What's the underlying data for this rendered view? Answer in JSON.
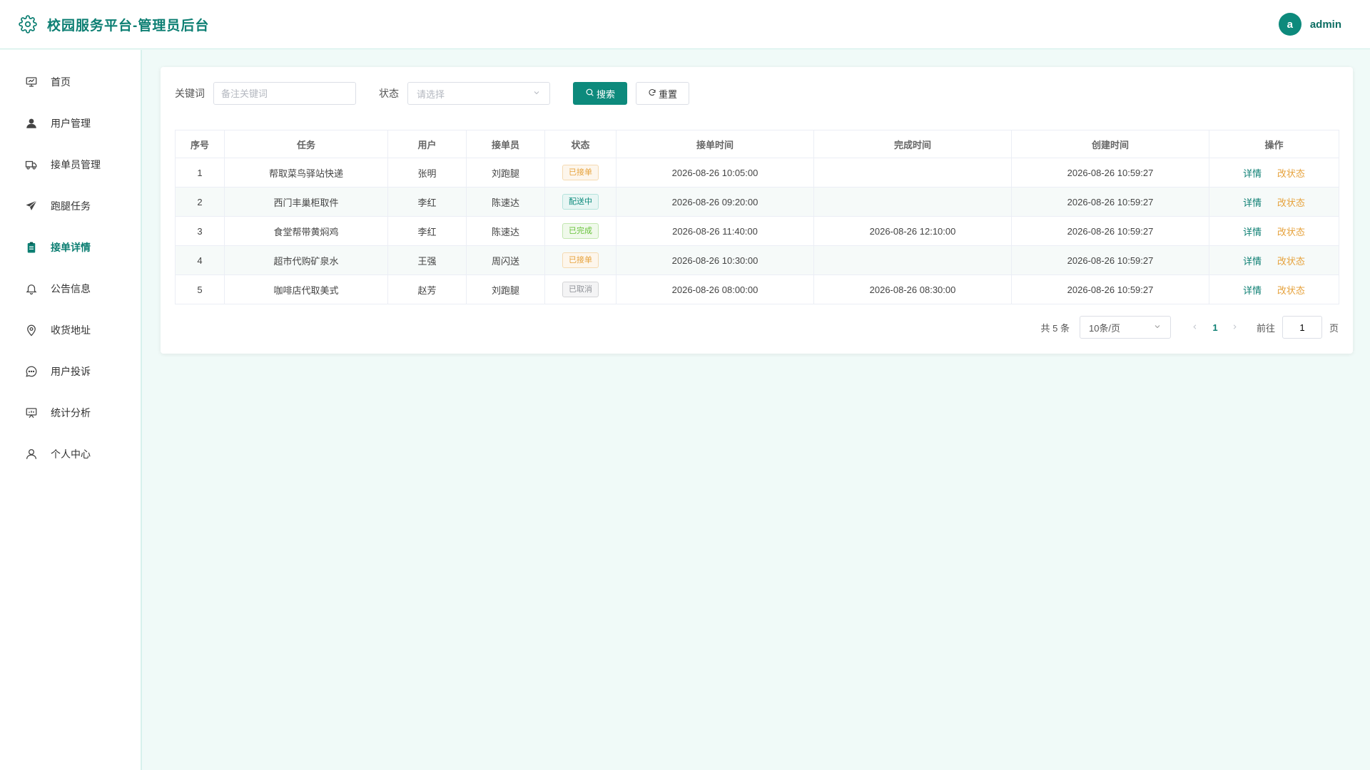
{
  "header": {
    "title": "校园服务平台-管理员后台",
    "avatar_letter": "a",
    "username": "admin"
  },
  "sidebar": {
    "items": [
      {
        "label": "首页",
        "icon": "monitor-icon"
      },
      {
        "label": "用户管理",
        "icon": "user-icon"
      },
      {
        "label": "接单员管理",
        "icon": "truck-icon"
      },
      {
        "label": "跑腿任务",
        "icon": "send-icon"
      },
      {
        "label": "接单详情",
        "icon": "clipboard-icon",
        "active": true
      },
      {
        "label": "公告信息",
        "icon": "bell-icon"
      },
      {
        "label": "收货地址",
        "icon": "location-icon"
      },
      {
        "label": "用户投诉",
        "icon": "chat-icon"
      },
      {
        "label": "统计分析",
        "icon": "chart-board-icon"
      },
      {
        "label": "个人中心",
        "icon": "person-outline-icon"
      }
    ]
  },
  "filters": {
    "keyword_label": "关键词",
    "keyword_placeholder": "备注关键词",
    "keyword_value": "",
    "status_label": "状态",
    "status_placeholder": "请选择",
    "search_label": "搜索",
    "reset_label": "重置"
  },
  "table": {
    "headers": [
      "序号",
      "任务",
      "用户",
      "接单员",
      "状态",
      "接单时间",
      "完成时间",
      "创建时间",
      "操作"
    ],
    "rows": [
      {
        "no": "1",
        "task": "帮取菜鸟驿站快递",
        "user": "张明",
        "runner": "刘跑腿",
        "status": "已接单",
        "status_type": "accepted",
        "accept_time": "2026-08-26 10:05:00",
        "finish_time": "",
        "create_time": "2026-08-26 10:59:27"
      },
      {
        "no": "2",
        "task": "西门丰巢柜取件",
        "user": "李红",
        "runner": "陈速达",
        "status": "配送中",
        "status_type": "delivering",
        "accept_time": "2026-08-26 09:20:00",
        "finish_time": "",
        "create_time": "2026-08-26 10:59:27"
      },
      {
        "no": "3",
        "task": "食堂帮带黄焖鸡",
        "user": "李红",
        "runner": "陈速达",
        "status": "已完成",
        "status_type": "done",
        "accept_time": "2026-08-26 11:40:00",
        "finish_time": "2026-08-26 12:10:00",
        "create_time": "2026-08-26 10:59:27"
      },
      {
        "no": "4",
        "task": "超市代购矿泉水",
        "user": "王强",
        "runner": "周闪送",
        "status": "已接单",
        "status_type": "accepted",
        "accept_time": "2026-08-26 10:30:00",
        "finish_time": "",
        "create_time": "2026-08-26 10:59:27"
      },
      {
        "no": "5",
        "task": "咖啡店代取美式",
        "user": "赵芳",
        "runner": "刘跑腿",
        "status": "已取消",
        "status_type": "cancelled",
        "accept_time": "2026-08-26 08:00:00",
        "finish_time": "2026-08-26 08:30:00",
        "create_time": "2026-08-26 10:59:27"
      }
    ],
    "op_detail": "详情",
    "op_status": "改状态"
  },
  "pagination": {
    "total": "共 5 条",
    "page_size": "10条/页",
    "current_page": "1",
    "goto_label": "前往",
    "goto_value": "1",
    "page_unit": "页"
  },
  "colors": {
    "primary": "#0d8a7c",
    "accepted": "#e6a23c",
    "done": "#67c23a",
    "cancelled": "#909399"
  }
}
